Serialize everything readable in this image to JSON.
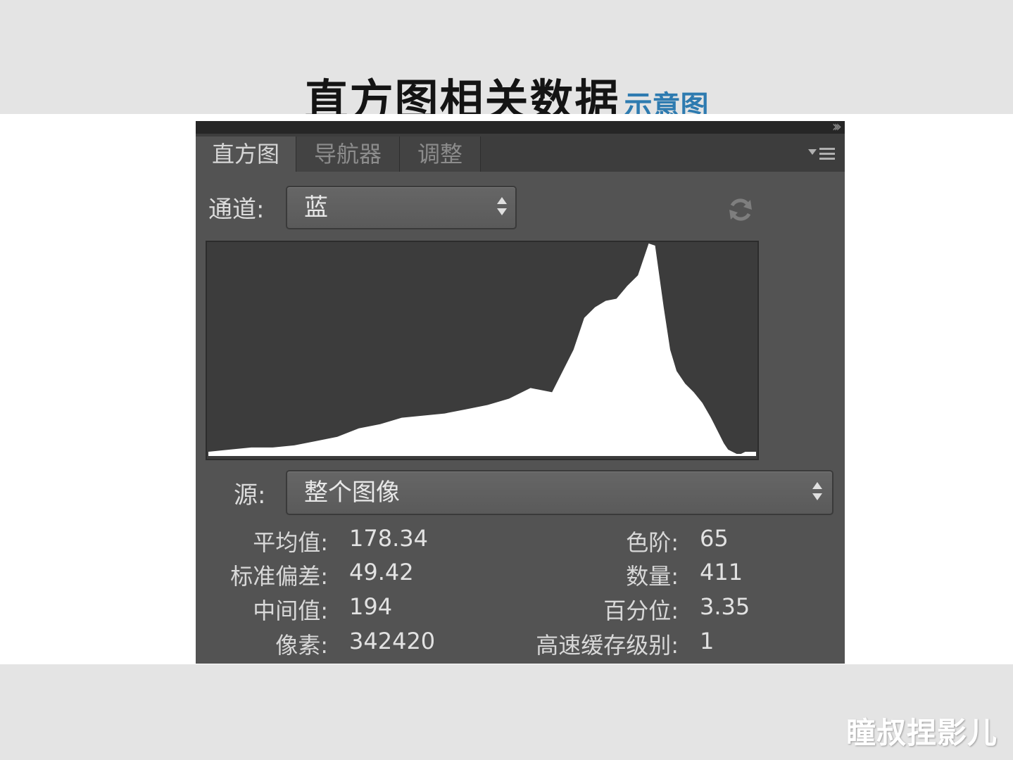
{
  "slide": {
    "title": "直方图相关数据",
    "subtitle": "示意图",
    "watermark": "瞳叔捏影儿"
  },
  "panel": {
    "tabs": [
      {
        "label": "直方图",
        "active": true
      },
      {
        "label": "导航器",
        "active": false
      },
      {
        "label": "调整",
        "active": false
      }
    ],
    "channel": {
      "label": "通道:",
      "value": "蓝"
    },
    "source": {
      "label": "源:",
      "value": "整个图像"
    },
    "stats_left": [
      {
        "label": "平均值:",
        "value": "178.34"
      },
      {
        "label": "标准偏差:",
        "value": "49.42"
      },
      {
        "label": "中间值:",
        "value": "194"
      },
      {
        "label": "像素:",
        "value": "342420"
      }
    ],
    "stats_right": [
      {
        "label": "色阶:",
        "value": "65"
      },
      {
        "label": "数量:",
        "value": "411"
      },
      {
        "label": "百分位:",
        "value": "3.35"
      },
      {
        "label": "高速缓存级别:",
        "value": "1"
      }
    ],
    "icons": {
      "collapse": "double-chevron-icon",
      "menu": "panel-menu-icon",
      "refresh": "refresh-icon",
      "dropdown": "up-down-arrows-icon"
    }
  },
  "colors": {
    "panel_bg": "#535353",
    "histogram_bg": "#3c3c3c",
    "histogram_fill": "#ffffff",
    "subtitle": "#2e7bb0"
  },
  "chart_data": {
    "type": "area",
    "x_range": [
      0,
      255
    ],
    "y_range": [
      0,
      1
    ],
    "x": [
      0,
      10,
      20,
      30,
      40,
      50,
      60,
      70,
      80,
      90,
      100,
      110,
      120,
      130,
      140,
      150,
      160,
      170,
      175,
      180,
      185,
      190,
      195,
      200,
      205,
      208,
      212,
      215,
      218,
      222,
      226,
      230,
      234,
      238,
      240,
      242,
      244,
      246,
      248,
      250,
      252,
      255
    ],
    "values": [
      0.02,
      0.03,
      0.04,
      0.04,
      0.05,
      0.07,
      0.09,
      0.13,
      0.15,
      0.18,
      0.19,
      0.2,
      0.22,
      0.24,
      0.27,
      0.32,
      0.3,
      0.5,
      0.65,
      0.7,
      0.73,
      0.74,
      0.8,
      0.85,
      1.0,
      0.99,
      0.7,
      0.5,
      0.4,
      0.34,
      0.3,
      0.25,
      0.18,
      0.1,
      0.06,
      0.03,
      0.02,
      0.01,
      0.01,
      0.02,
      0.02,
      0.02
    ]
  }
}
